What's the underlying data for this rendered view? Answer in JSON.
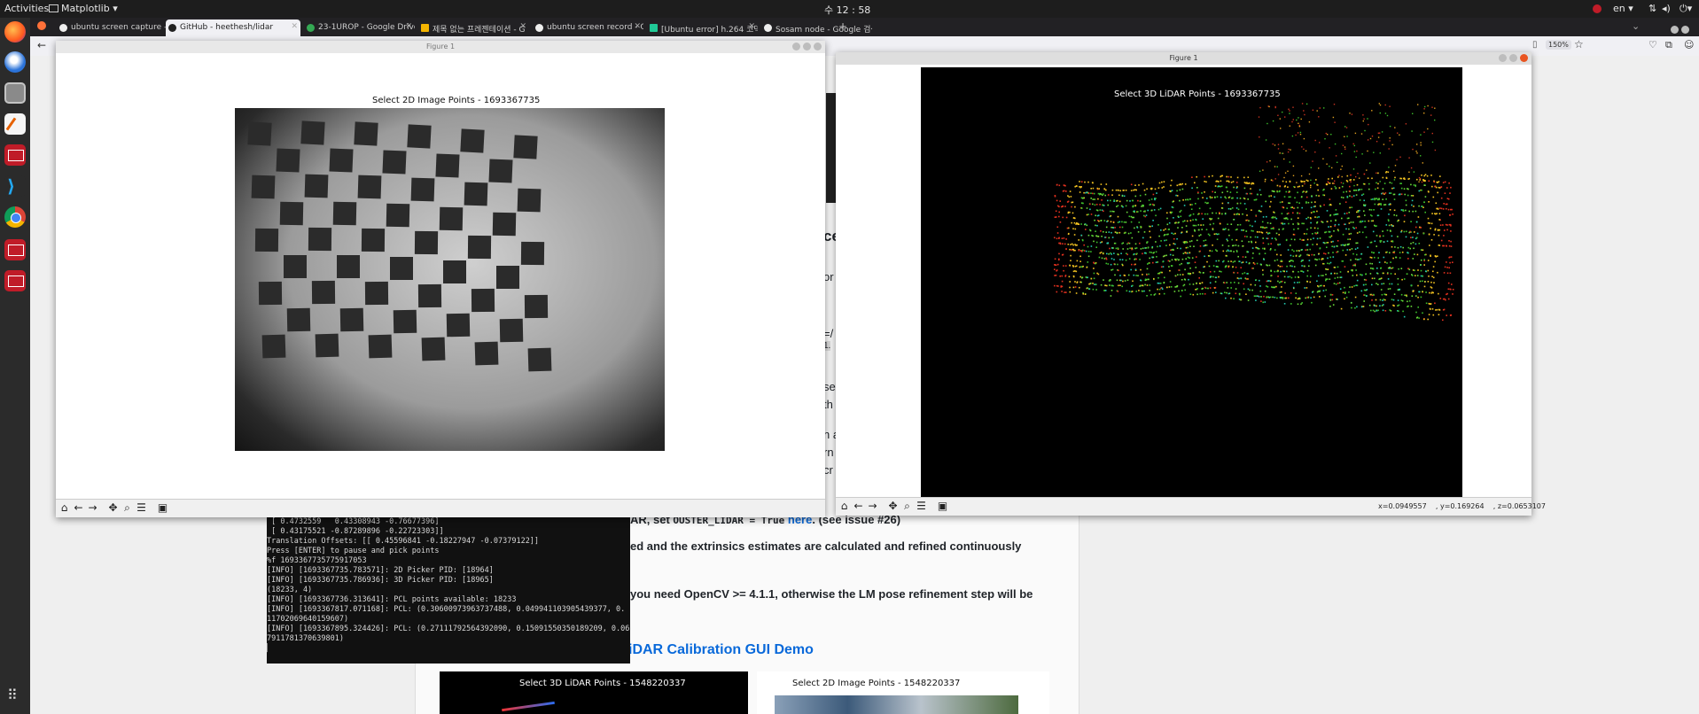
{
  "topbar": {
    "activities": "Activities",
    "app_menu": "Matplotlib ▾",
    "clock": "수 12 : 58",
    "language": "en ▾",
    "icons": [
      "record-icon",
      "network-icon",
      "volume-icon",
      "power-icon"
    ]
  },
  "dock": {
    "items": [
      "firefox-icon",
      "thunderbird-icon",
      "files-icon",
      "text-editor-icon",
      "screen-recorder-icon",
      "vscode-icon",
      "chrome-icon",
      "image-viewer-icon",
      "image-viewer-icon-2"
    ],
    "apps_grid": "show-applications-icon"
  },
  "browser": {
    "tabs": [
      {
        "label": "ubuntu screen capture -",
        "color": "#ffffff"
      },
      {
        "label": "GitHub - heethesh/lidar",
        "color": "#ffffff",
        "active": true
      },
      {
        "label": "23-1UROP - Google Drive",
        "color": "#34a853"
      },
      {
        "label": "제목 없는 프레젠테이션 - G",
        "color": "#f4b400"
      },
      {
        "label": "ubuntu screen record - G",
        "color": "#ffffff"
      },
      {
        "label": "[Ubuntu error] h.264 코덱",
        "color": "#20c997"
      },
      {
        "label": "Sosam node - Google 검색",
        "color": "#ffffff"
      }
    ],
    "new_tab": "+",
    "zoom": "150%"
  },
  "page": {
    "fragments": [
      "ce",
      "or",
      "=/",
      "1.",
      "se",
      "th",
      "n a",
      "rn",
      "cr"
    ],
    "env_line_pre": "AR, set ",
    "env_code": "OUSTER_LIDAR = True",
    "env_link": "here",
    "env_line_post": ". (see issue #26)",
    "refine_line": "ed and the extrinsics estimates are calculated and refined continuously",
    "opencv_line": "you need OpenCV >= 4.1.1, otherwise the LM pose refinement step will be",
    "demo_heading": "iDAR Calibration GUI Demo",
    "demo_left_title": "Select 3D LiDAR Points - 1548220337",
    "demo_right_title": "Select 2D Image Points - 1548220337"
  },
  "figure_2d": {
    "window_title": "Figure 1",
    "axes_title": "Select 2D Image Points - 1693367735"
  },
  "figure_3d": {
    "window_title": "Figure 1",
    "axes_title": "Select 3D LiDAR Points - 1693367735",
    "coords": "x=0.0949557    , y=0.169264    , z=0.0653107"
  },
  "toolbar_icons": [
    "home-icon",
    "back-icon",
    "forward-icon",
    "pan-icon",
    "zoom-icon",
    "configure-icon",
    "save-icon"
  ],
  "terminal": {
    "lines": [
      " [ 0.4732559   0.43308943 -0.76677396]",
      " [ 0.43175521 -0.87289896 -0.22723303]]",
      "Translation Offsets: [[ 0.45596841 -0.18227947 -0.07379122]]",
      "Press [ENTER] to pause and pick points",
      "",
      "%f 1693367735775917053",
      "[INFO] [1693367735.783571]: 2D Picker PID: [18964]",
      "[INFO] [1693367735.786936]: 3D Picker PID: [18965]",
      "(18233, 4)",
      "[INFO] [1693367736.313641]: PCL points available: 18233",
      "[INFO] [1693367817.071168]: PCL: (0.30600973963737488, 0.049941103905439377, 0.",
      "11702069640159607)",
      "[INFO] [1693367895.324426]: PCL: (0.27111792564392090, 0.15091550350189209, 0.06",
      "7911781370639801)"
    ]
  }
}
